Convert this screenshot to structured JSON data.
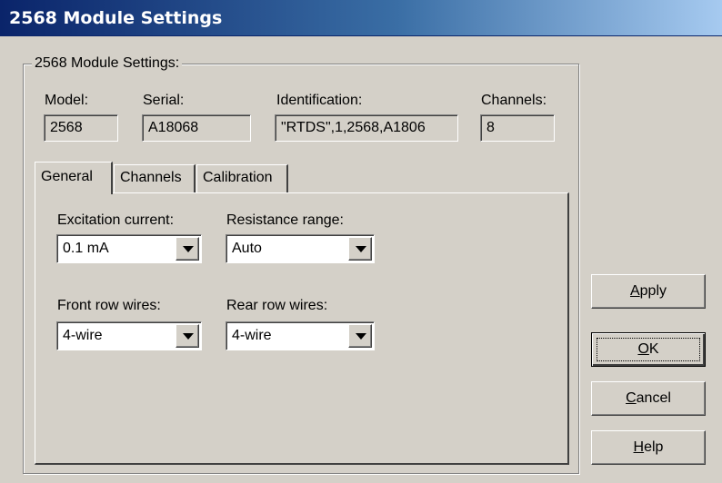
{
  "window": {
    "title": "2568 Module Settings"
  },
  "group": {
    "label": "2568 Module Settings:"
  },
  "info": {
    "model_label": "Model:",
    "model_value": "2568",
    "serial_label": "Serial:",
    "serial_value": "A18068",
    "ident_label": "Identification:",
    "ident_value": "\"RTDS\",1,2568,A1806",
    "channels_label": "Channels:",
    "channels_value": "8"
  },
  "tabs": [
    {
      "label": "General",
      "active": true
    },
    {
      "label": "Channels",
      "active": false
    },
    {
      "label": "Calibration",
      "active": false
    }
  ],
  "general": {
    "excitation_label": "Excitation current:",
    "excitation_value": "0.1 mA",
    "resistance_label": "Resistance range:",
    "resistance_value": "Auto",
    "front_label": "Front row wires:",
    "front_value": "4-wire",
    "rear_label": "Rear row wires:",
    "rear_value": "4-wire"
  },
  "buttons": {
    "apply": {
      "first": "A",
      "rest": "pply"
    },
    "ok": {
      "first": "O",
      "rest": "K"
    },
    "cancel": {
      "first": "C",
      "rest": "ancel"
    },
    "help": {
      "first": "H",
      "rest": "elp"
    }
  },
  "icons": {
    "dropdown": "chevron-down-icon"
  }
}
